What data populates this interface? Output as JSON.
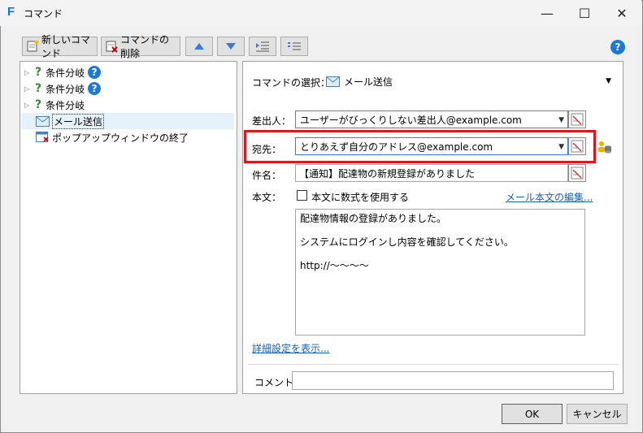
{
  "window": {
    "title": "コマンド",
    "minimize_glyph": "—",
    "maximize_glyph": "☐",
    "close_glyph": "✕"
  },
  "toolbar": {
    "new_command": "新しいコマンド",
    "delete_command": "コマンドの削除",
    "help_glyph": "?"
  },
  "tree": {
    "items": [
      {
        "label": "条件分岐",
        "has_help": true
      },
      {
        "label": "条件分岐",
        "has_help": true
      },
      {
        "label": "条件分岐",
        "has_help": false
      },
      {
        "label": "メール送信",
        "selected": true
      },
      {
        "label": "ポップアップウィンドウの終了"
      }
    ]
  },
  "form": {
    "command_select_label": "コマンドの選択：",
    "command_select_value": "メール送信",
    "sender_label": "差出人：",
    "sender_value": "ユーザーがびっくりしない差出人@example.com",
    "recipient_label": "宛先：",
    "recipient_value": "とりあえず自分のアドレス@example.com",
    "subject_label": "件名：",
    "subject_value": "【通知】配達物の新規登録がありました",
    "body_label": "本文：",
    "use_formula_label": "本文に数式を使用する",
    "edit_body_link": "メール本文の編集...",
    "body_lines": [
      "配達物情報の登録がありました。",
      "",
      "システムにログインし内容を確認してください。",
      "",
      "http://～～～～"
    ],
    "advanced_link": "詳細設定を表示...",
    "comment_label": "コメント",
    "comment_value": ""
  },
  "footer": {
    "ok": "OK",
    "cancel": "キャンセル"
  },
  "colors": {
    "accent": "#1e78d7",
    "highlight_box": "#e0161b",
    "selected_row": "#e5f1fb"
  }
}
